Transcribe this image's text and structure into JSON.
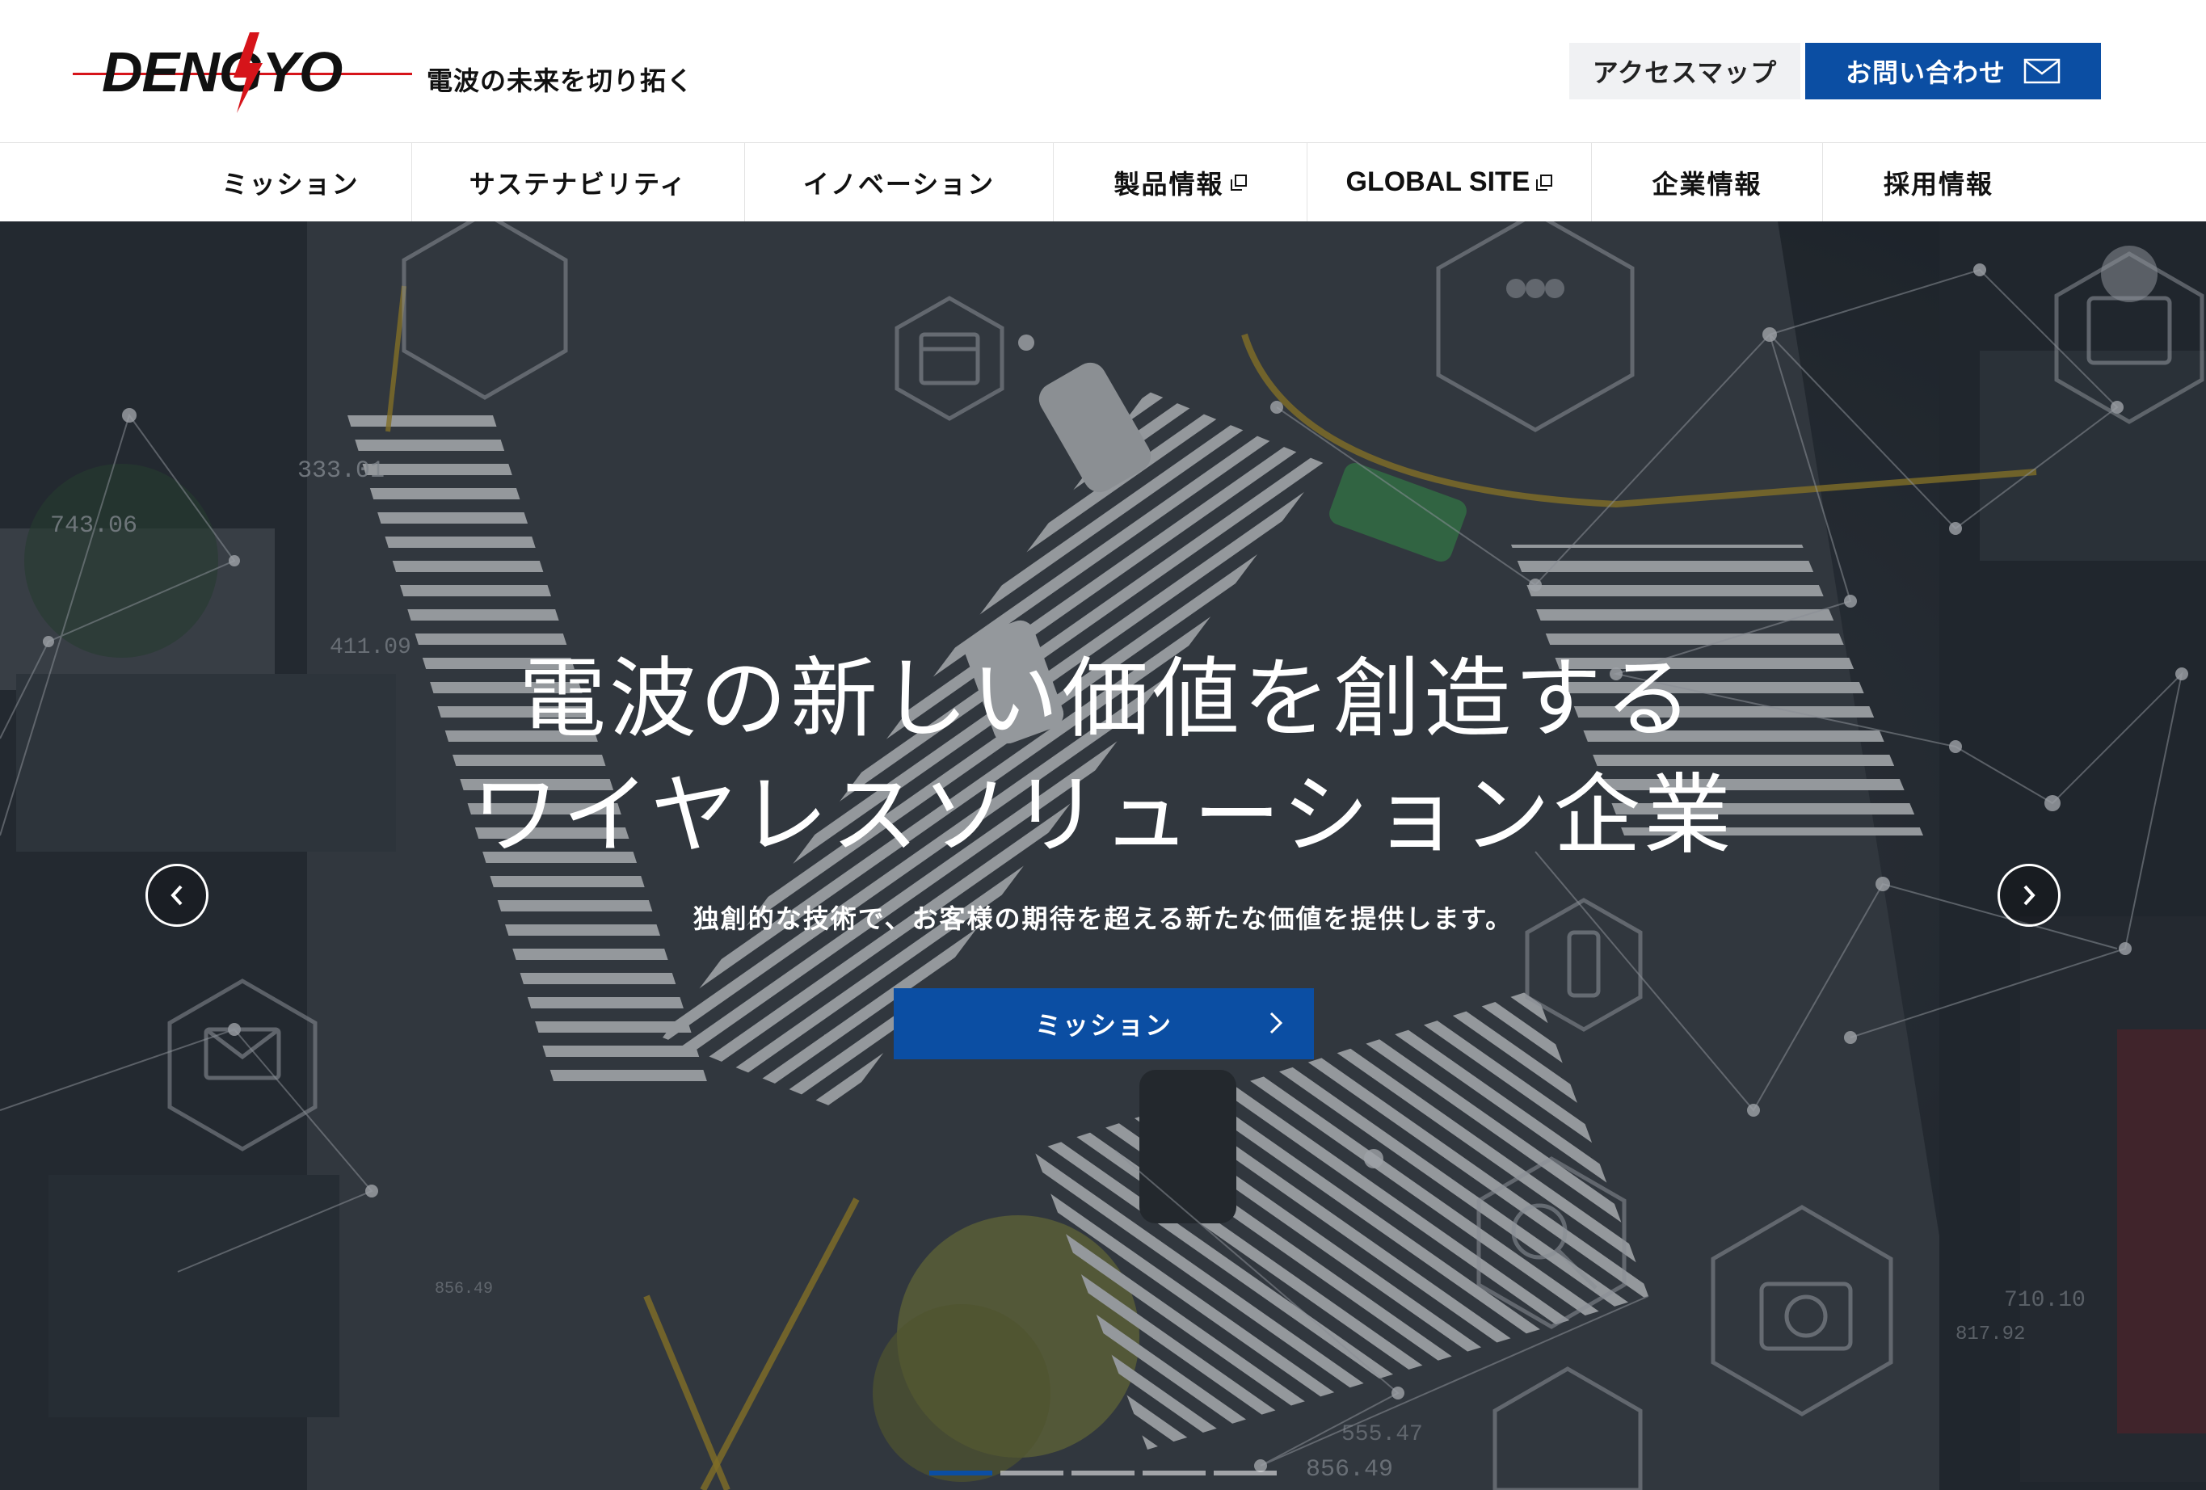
{
  "header": {
    "logo_text": "DENGYO",
    "tagline": "電波の未来を切り拓く",
    "access_label": "アクセスマップ",
    "contact_label": "お問い合わせ"
  },
  "nav": {
    "items": [
      {
        "label": "ミッション"
      },
      {
        "label": "サステナビリティ"
      },
      {
        "label": "イノベーション"
      },
      {
        "label": "製品情報",
        "external": true
      },
      {
        "label": "GLOBAL SITE",
        "external": true
      },
      {
        "label": "企業情報"
      },
      {
        "label": "採用情報"
      }
    ]
  },
  "hero": {
    "title_line1": "電波の新しい価値を創造する",
    "title_line2": "ワイヤレスソリューション企業",
    "subtitle": "独創的な技術で、お客様の期待を超える新たな価値を提供します。",
    "cta_label": "ミッション",
    "bg_labels": [
      "333.01",
      "743.06",
      "411.09",
      "856.49",
      "710.10",
      "817.92",
      "555.47",
      "856.49"
    ],
    "slides_total": 5,
    "active_slide": 1
  },
  "colors": {
    "brand_blue": "#0b4ea3",
    "logo_red": "#d6141a",
    "nav_text": "#111111"
  }
}
